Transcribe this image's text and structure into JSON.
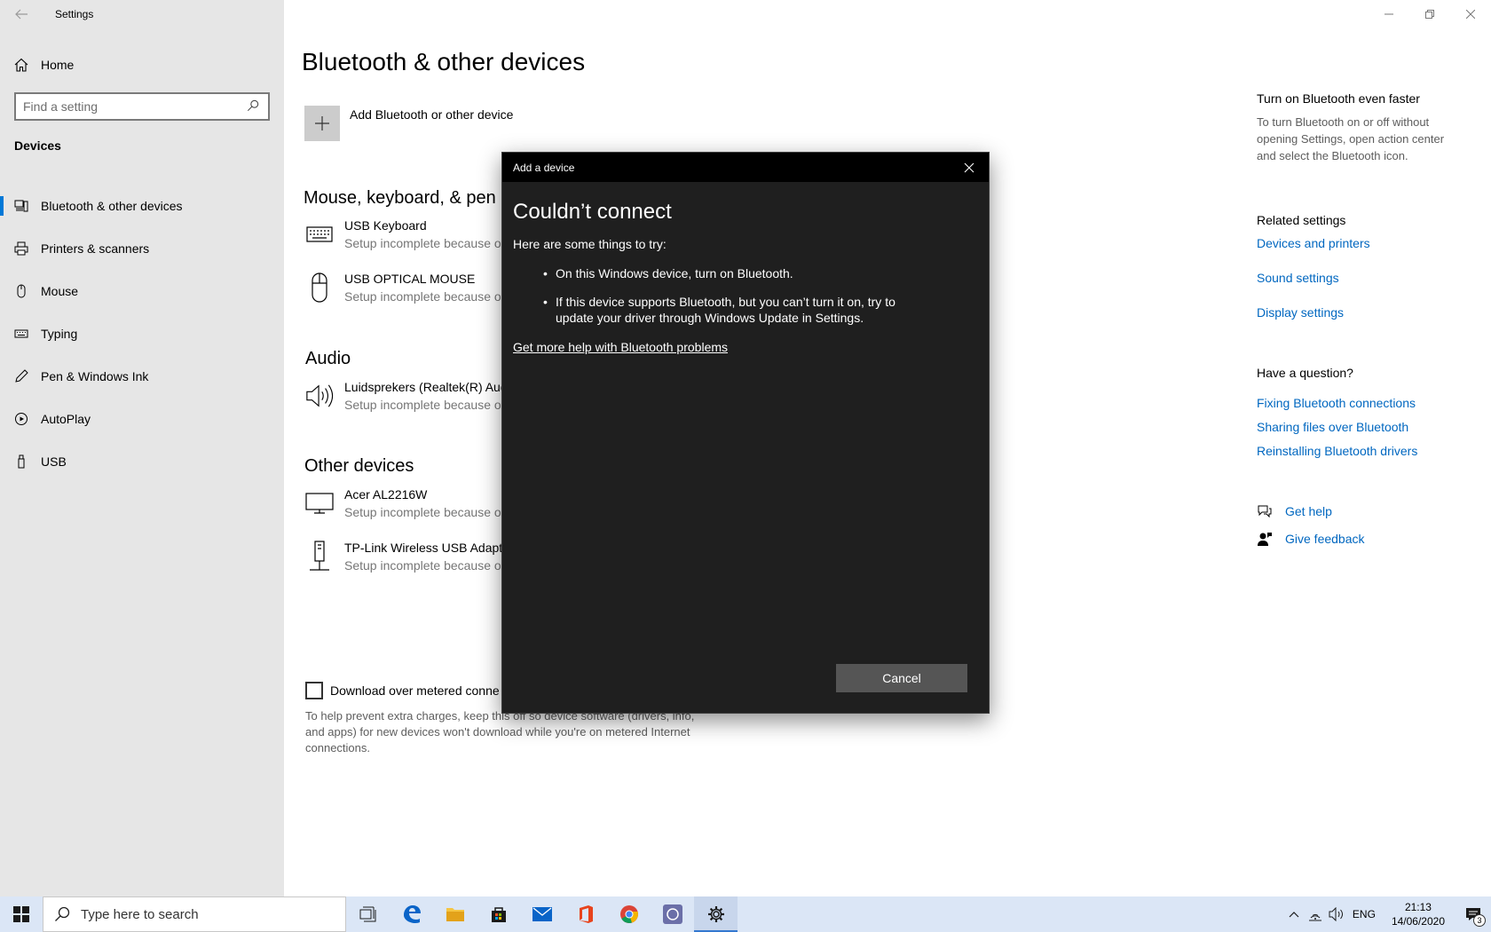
{
  "app": {
    "title": "Settings"
  },
  "sidebar": {
    "home_label": "Home",
    "search_placeholder": "Find a setting",
    "section": "Devices",
    "items": [
      {
        "label": "Bluetooth & other devices",
        "icon": "bluetooth-devices-icon",
        "active": true
      },
      {
        "label": "Printers & scanners",
        "icon": "printer-icon"
      },
      {
        "label": "Mouse",
        "icon": "mouse-icon"
      },
      {
        "label": "Typing",
        "icon": "keyboard-icon"
      },
      {
        "label": "Pen & Windows Ink",
        "icon": "pen-icon"
      },
      {
        "label": "AutoPlay",
        "icon": "autoplay-icon"
      },
      {
        "label": "USB",
        "icon": "usb-icon"
      }
    ]
  },
  "main": {
    "title": "Bluetooth & other devices",
    "add_device_label": "Add Bluetooth or other device",
    "groups": {
      "mouse_keyboard": {
        "title": "Mouse, keyboard, & pen",
        "devices": [
          {
            "name": "USB Keyboard",
            "status": "Setup incomplete because o"
          },
          {
            "name": "USB OPTICAL MOUSE",
            "status": "Setup incomplete because o"
          }
        ]
      },
      "audio": {
        "title": "Audio",
        "devices": [
          {
            "name": "Luidsprekers (Realtek(R) Aud",
            "status": "Setup incomplete because o"
          }
        ]
      },
      "other": {
        "title": "Other devices",
        "devices": [
          {
            "name": "Acer AL2216W",
            "status": "Setup incomplete because o"
          },
          {
            "name": "TP-Link Wireless USB Adapte",
            "status": "Setup incomplete because o"
          }
        ]
      }
    },
    "metered_label": "Download over metered conne",
    "metered_desc": "To help prevent extra charges, keep this off so device software (drivers, info, and apps) for new devices won't download while you're on metered Internet connections."
  },
  "rail": {
    "faster_title": "Turn on Bluetooth even faster",
    "faster_desc": "To turn Bluetooth on or off without opening Settings, open action center and select the Bluetooth icon.",
    "related_title": "Related settings",
    "related_links": [
      "Devices and printers",
      "Sound settings",
      "Display settings"
    ],
    "question_title": "Have a question?",
    "question_links": [
      "Fixing Bluetooth connections",
      "Sharing files over Bluetooth",
      "Reinstalling Bluetooth drivers"
    ],
    "get_help": "Get help",
    "give_feedback": "Give feedback"
  },
  "dialog": {
    "title": "Add a device",
    "heading": "Couldn’t connect",
    "subheading": "Here are some things to try:",
    "tips": [
      "On this Windows device, turn on Bluetooth.",
      "If this device supports Bluetooth, but you can’t turn it on, try to update your driver through Windows Update in Settings."
    ],
    "help_link": "Get more help with Bluetooth problems",
    "cancel_label": "Cancel"
  },
  "taskbar": {
    "search_placeholder": "Type here to search",
    "apps": [
      "task-view-icon",
      "edge-icon",
      "file-explorer-icon",
      "store-icon",
      "mail-icon",
      "office-icon",
      "chrome-icon",
      "app-icon",
      "settings-gear-icon"
    ],
    "lang": "ENG",
    "time": "21:13",
    "date": "14/06/2020",
    "notification_count": "3"
  },
  "colors": {
    "accent": "#0078d7",
    "link": "#0067c0",
    "dialog_bg": "#1f1f1f",
    "taskbar_bg": "#dbe6f6"
  }
}
